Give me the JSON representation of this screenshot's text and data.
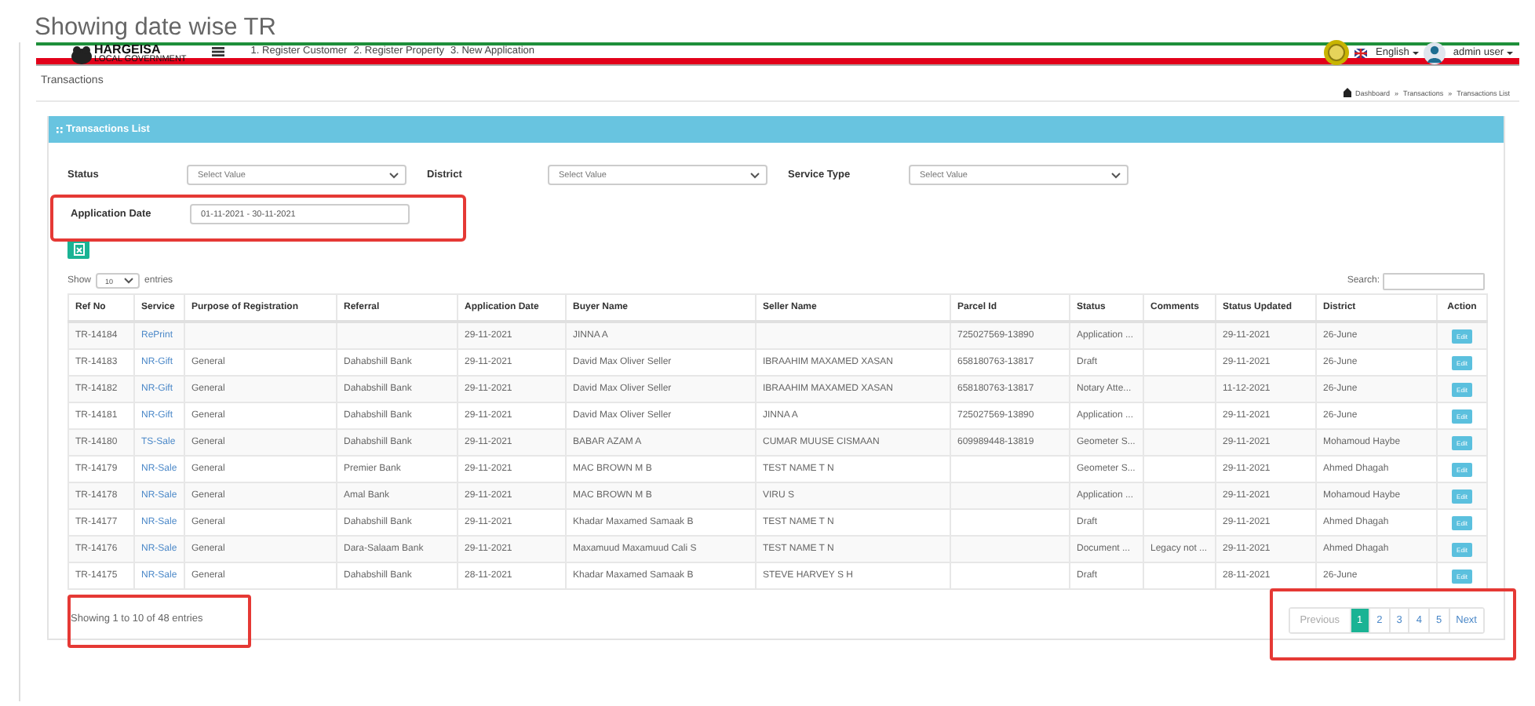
{
  "page_title": "Showing date wise TR",
  "header": {
    "logo_text": "HARGEISA",
    "logo_subtext": "LOCAL GOVERNMENT",
    "nav_items": [
      "1. Register Customer",
      "2. Register Property",
      "3. New Application"
    ],
    "language": "English",
    "user": "admin user"
  },
  "page_heading": "Transactions",
  "breadcrumbs": [
    "Dashboard",
    "Transactions",
    "Transactions List"
  ],
  "breadcrumb_separator": "»",
  "card_title": "Transactions List",
  "filters": [
    {
      "kind": "select",
      "label": "Status",
      "placeholder": "Select Value"
    },
    {
      "kind": "select",
      "label": "District",
      "placeholder": "Select Value"
    },
    {
      "kind": "select",
      "label": "Service Type",
      "placeholder": "Select Value"
    },
    {
      "kind": "date",
      "label": "Application Date",
      "value": "01-11-2021 - 30-11-2021",
      "highlighted": true
    }
  ],
  "length_menu": {
    "show_label": "Show",
    "value": "10",
    "entries_label": "entries"
  },
  "search": {
    "label": "Search:"
  },
  "table": {
    "columns": [
      {
        "label": "Ref No",
        "kind": "text"
      },
      {
        "label": "Service",
        "kind": "link"
      },
      {
        "label": "Purpose of Registration",
        "kind": "text"
      },
      {
        "label": "Referral",
        "kind": "text"
      },
      {
        "label": "Application Date",
        "kind": "text"
      },
      {
        "label": "Buyer Name",
        "kind": "text"
      },
      {
        "label": "Seller Name",
        "kind": "text"
      },
      {
        "label": "Parcel Id",
        "kind": "text"
      },
      {
        "label": "Status",
        "kind": "text"
      },
      {
        "label": "Comments",
        "kind": "text"
      },
      {
        "label": "Status Updated",
        "kind": "text"
      },
      {
        "label": "District",
        "kind": "text"
      },
      {
        "label": "Action",
        "kind": "button"
      }
    ],
    "rows": [
      [
        "TR-14184",
        "RePrint",
        "",
        "",
        "29-11-2021",
        "JINNA A",
        "",
        "725027569-13890",
        "Application ...",
        "",
        "29-11-2021",
        "26-June",
        "Edit"
      ],
      [
        "TR-14183",
        "NR-Gift",
        "General",
        "Dahabshill Bank",
        "29-11-2021",
        "David Max Oliver Seller",
        "IBRAAHIM MAXAMED XASAN",
        "658180763-13817",
        "Draft",
        "",
        "29-11-2021",
        "26-June",
        "Edit"
      ],
      [
        "TR-14182",
        "NR-Gift",
        "General",
        "Dahabshill Bank",
        "29-11-2021",
        "David Max Oliver Seller",
        "IBRAAHIM MAXAMED XASAN",
        "658180763-13817",
        "Notary Atte...",
        "",
        "11-12-2021",
        "26-June",
        "Edit"
      ],
      [
        "TR-14181",
        "NR-Gift",
        "General",
        "Dahabshill Bank",
        "29-11-2021",
        "David Max Oliver Seller",
        "JINNA A",
        "725027569-13890",
        "Application ...",
        "",
        "29-11-2021",
        "26-June",
        "Edit"
      ],
      [
        "TR-14180",
        "TS-Sale",
        "General",
        "Dahabshill Bank",
        "29-11-2021",
        "BABAR AZAM A",
        "CUMAR MUUSE CISMAAN",
        "609989448-13819",
        "Geometer S...",
        "",
        "29-11-2021",
        "Mohamoud Haybe",
        "Edit"
      ],
      [
        "TR-14179",
        "NR-Sale",
        "General",
        "Premier Bank",
        "29-11-2021",
        "MAC BROWN M B",
        "TEST NAME T N",
        "",
        "Geometer S...",
        "",
        "29-11-2021",
        "Ahmed Dhagah",
        "Edit"
      ],
      [
        "TR-14178",
        "NR-Sale",
        "General",
        "Amal Bank",
        "29-11-2021",
        "MAC BROWN M B",
        "VIRU S",
        "",
        "Application ...",
        "",
        "29-11-2021",
        "Mohamoud Haybe",
        "Edit"
      ],
      [
        "TR-14177",
        "NR-Sale",
        "General",
        "Dahabshill Bank",
        "29-11-2021",
        "Khadar Maxamed Samaak B",
        "TEST NAME T N",
        "",
        "Draft",
        "",
        "29-11-2021",
        "Ahmed Dhagah",
        "Edit"
      ],
      [
        "TR-14176",
        "NR-Sale",
        "General",
        "Dara-Salaam Bank",
        "29-11-2021",
        "Maxamuud Maxamuud Cali S",
        "TEST NAME T N",
        "",
        "Document ...",
        "Legacy not ...",
        "29-11-2021",
        "Ahmed Dhagah",
        "Edit"
      ],
      [
        "TR-14175",
        "NR-Sale",
        "General",
        "Dahabshill Bank",
        "28-11-2021",
        "Khadar Maxamed Samaak B",
        "STEVE HARVEY S H",
        "",
        "Draft",
        "",
        "28-11-2021",
        "26-June",
        "Edit"
      ]
    ]
  },
  "info": {
    "text": "Showing 1 to 10 of 48 entries",
    "highlighted": true
  },
  "pagination": {
    "highlighted": true,
    "items": [
      {
        "label": "Previous",
        "selected": false,
        "disabled": true
      },
      {
        "label": "1",
        "selected": true,
        "disabled": false
      },
      {
        "label": "2",
        "selected": false,
        "disabled": false
      },
      {
        "label": "3",
        "selected": false,
        "disabled": false
      },
      {
        "label": "4",
        "selected": false,
        "disabled": false
      },
      {
        "label": "5",
        "selected": false,
        "disabled": false
      },
      {
        "label": "Next",
        "selected": false,
        "disabled": false
      }
    ]
  }
}
